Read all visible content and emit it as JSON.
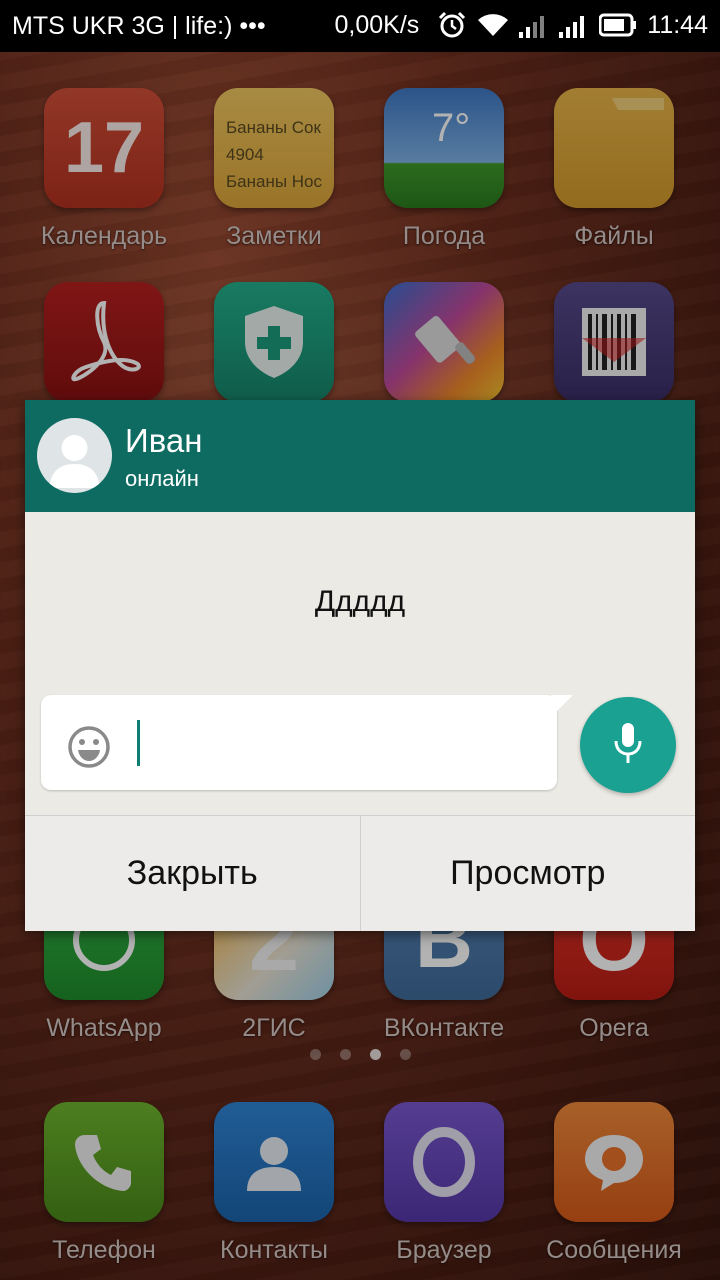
{
  "status_bar": {
    "carrier": "MTS UKR 3G | life:) •••",
    "speed": "0,00K/s",
    "time": "11:44",
    "icons": [
      "alarm-icon",
      "wifi-icon",
      "signal-icon",
      "signal-icon",
      "battery-icon"
    ]
  },
  "apps": [
    {
      "name": "Календарь",
      "icon": "calendar-icon",
      "text": "17",
      "color": "#c9402b"
    },
    {
      "name": "Заметки",
      "icon": "notes-icon",
      "lines": [
        "Бананы Сок",
        "4904",
        "Бананы Нос"
      ],
      "color": "#e8b94a"
    },
    {
      "name": "Погода",
      "icon": "weather-icon",
      "text": "7°",
      "color": "#4a86c8"
    },
    {
      "name": "Файлы",
      "icon": "folder-icon",
      "color": "#e0a93b"
    },
    {
      "name": "",
      "icon": "pdf-reader-icon",
      "color": "#a3191a"
    },
    {
      "name": "",
      "icon": "security-shield-icon",
      "color": "#1c9b7c"
    },
    {
      "name": "",
      "icon": "themes-brush-icon",
      "color": "#e25a3a"
    },
    {
      "name": "",
      "icon": "barcode-scanner-icon",
      "color": "#4a3d7a"
    },
    {
      "name": "WhatsApp",
      "icon": "whatsapp-icon",
      "color": "#2aa53a"
    },
    {
      "name": "2ГИС",
      "icon": "2gis-icon",
      "text": "2",
      "color": "#f0a030"
    },
    {
      "name": "ВКонтакте",
      "icon": "vk-icon",
      "text": "В",
      "color": "#4a76a8"
    },
    {
      "name": "Opera",
      "icon": "opera-icon",
      "text": "O",
      "color": "#d8281f"
    }
  ],
  "dock": [
    {
      "name": "Телефон",
      "icon": "phone-icon",
      "color": "#5fa324"
    },
    {
      "name": "Контакты",
      "icon": "contacts-icon",
      "color": "#2478c8"
    },
    {
      "name": "Браузер",
      "icon": "browser-icon",
      "color": "#6a4bc0"
    },
    {
      "name": "Сообщения",
      "icon": "messages-icon",
      "color": "#e8702a"
    }
  ],
  "pager": {
    "count": 4,
    "active": 3
  },
  "dialog": {
    "contact_name": "Иван",
    "contact_status": "онлайн",
    "message": "Ддддд",
    "reply_placeholder": "",
    "close_label": "Закрыть",
    "view_label": "Просмотр",
    "accent": "#0e6b61"
  }
}
